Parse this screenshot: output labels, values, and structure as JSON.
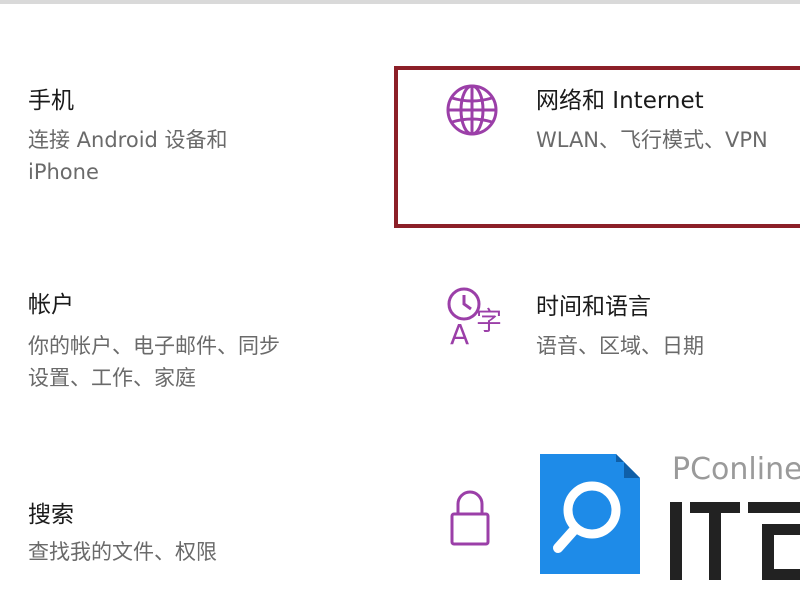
{
  "tiles": [
    {
      "title": "手机",
      "desc_line1": "连接 Android 设备和",
      "desc_line2": "iPhone"
    },
    {
      "title": "网络和 Internet",
      "desc_line1": "WLAN、飞行模式、VPN"
    },
    {
      "title": "帐户",
      "desc_line1": "你的帐户、电子邮件、同步",
      "desc_line2": "设置、工作、家庭"
    },
    {
      "title": "时间和语言",
      "desc_line1": "语音、区域、日期"
    },
    {
      "title": "搜索",
      "desc_line1": "查找我的文件、权限"
    }
  ],
  "icons": {
    "network": "globe-icon",
    "time_language": "clock-language-icon",
    "privacy": "lock-icon"
  },
  "watermark": {
    "brand": "PConline",
    "logo_text": "IT百科"
  },
  "colors": {
    "icon_accent": "#9b3fa8",
    "highlight_border": "#8c1f28",
    "logo_blue": "#1e8be8"
  }
}
